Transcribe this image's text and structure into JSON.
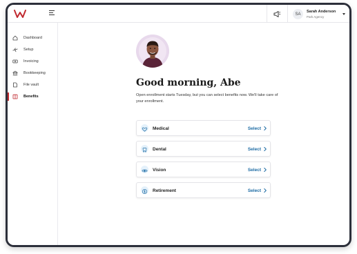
{
  "header": {
    "logo_icon": "brand-w-logo-icon",
    "menu_icon": "menu-toggle-icon",
    "announcement_icon": "megaphone-icon",
    "user": {
      "initials": "SA",
      "name": "Sarah Anderson",
      "company": "Park Agency"
    }
  },
  "sidebar": {
    "items": [
      {
        "label": "Dashboard",
        "icon": "home-icon"
      },
      {
        "label": "Setup",
        "icon": "airplane-icon"
      },
      {
        "label": "Invoicing",
        "icon": "money-icon"
      },
      {
        "label": "Bookkeeping",
        "icon": "bank-icon"
      },
      {
        "label": "File vault",
        "icon": "folder-icon"
      },
      {
        "label": "Benefits",
        "icon": "gift-icon",
        "active": true
      }
    ]
  },
  "main": {
    "greeting": "Good morning, Abe",
    "subtext": "Open enrollment starts Tuesday, but you can select benefits now. We'll take care of your enrollment.",
    "benefits": [
      {
        "name": "Medical",
        "action": "Select",
        "icon": "heart-icon"
      },
      {
        "name": "Dental",
        "action": "Select",
        "icon": "tooth-icon"
      },
      {
        "name": "Vision",
        "action": "Select",
        "icon": "eye-icon"
      },
      {
        "name": "Retirement",
        "action": "Select",
        "icon": "dollar-coin-icon"
      }
    ]
  },
  "colors": {
    "accent": "#c0282e",
    "link": "#1b6aa3",
    "icon_bg": "#e4f1fb",
    "frame": "#2c2f3a"
  }
}
